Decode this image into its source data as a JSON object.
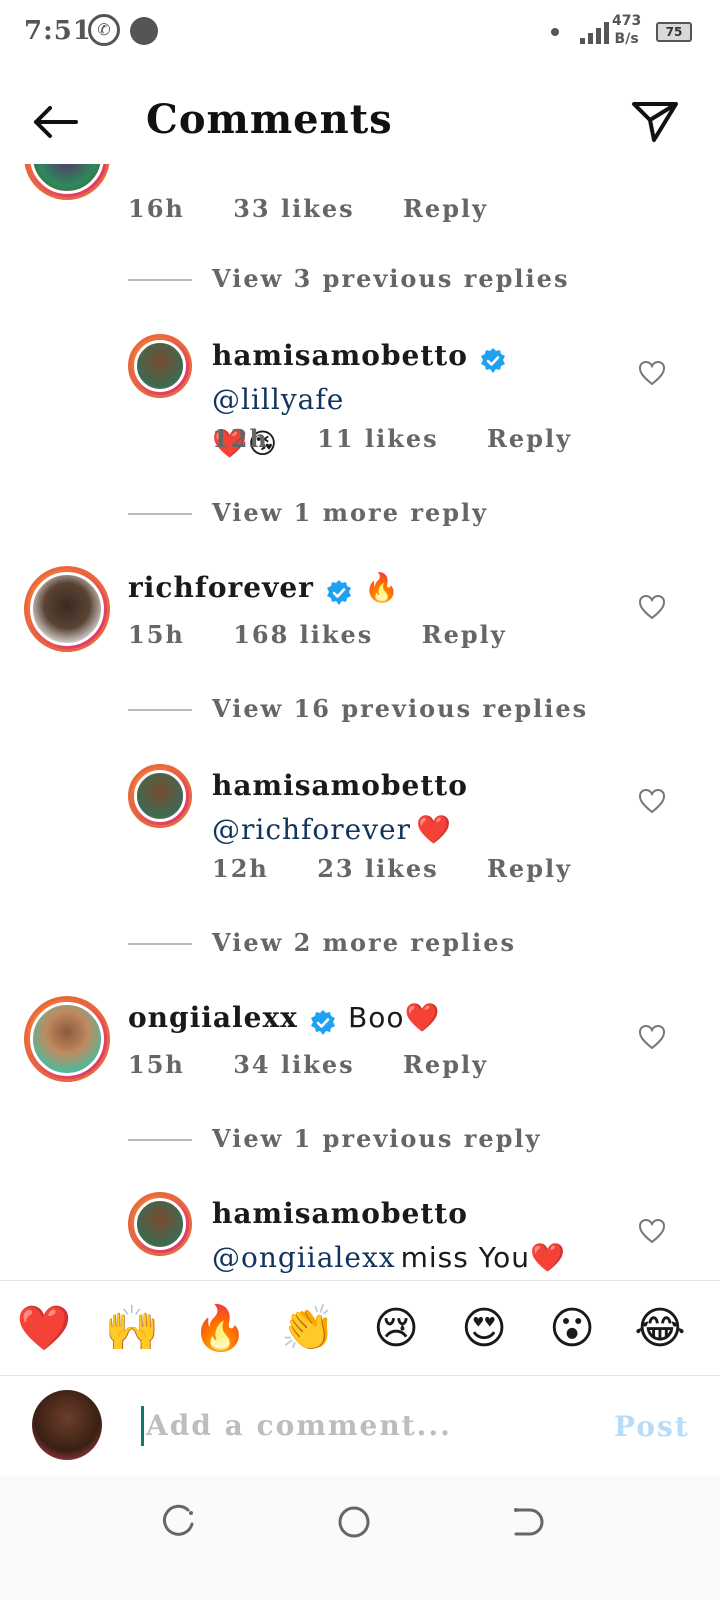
{
  "status_bar": {
    "time": "7:51",
    "net_speed_value": "473",
    "net_speed_unit": "B/s",
    "battery": "75"
  },
  "header": {
    "title": "Comments"
  },
  "comments": {
    "c0": {
      "time": "16h",
      "likes": "33 likes",
      "reply": "Reply"
    },
    "v0": {
      "text": "View 3 previous replies"
    },
    "r1": {
      "username": "hamisamobetto",
      "mention": "@lillyafe",
      "text": "❤️😘",
      "time": "12h",
      "likes": "11 likes",
      "reply": "Reply"
    },
    "v1": {
      "text": "View 1 more reply"
    },
    "c2": {
      "username": "richforever",
      "text": "🔥",
      "time": "15h",
      "likes": "168 likes",
      "reply": "Reply"
    },
    "v2": {
      "text": "View 16 previous replies"
    },
    "r3": {
      "username": "hamisamobetto",
      "mention": "@richforever",
      "text": "❤️",
      "time": "12h",
      "likes": "23 likes",
      "reply": "Reply"
    },
    "v3": {
      "text": "View 2 more replies"
    },
    "c4": {
      "username": "ongiialexx",
      "text": "Boo❤️",
      "time": "15h",
      "likes": "34 likes",
      "reply": "Reply"
    },
    "v4": {
      "text": "View 1 previous reply"
    },
    "r5": {
      "username": "hamisamobetto",
      "mention": "@ongiialexx",
      "text": "miss You❤️"
    }
  },
  "reactions": [
    "❤️",
    "🙌",
    "🔥",
    "👏",
    "😢",
    "😍",
    "😮",
    "😂"
  ],
  "input": {
    "placeholder": "Add a comment...",
    "post_label": "Post"
  },
  "colors": {
    "mention": "#10345c",
    "verified": "#1da1f2",
    "post_disabled": "#b8dcf7",
    "cursor": "#0f7b6c"
  }
}
